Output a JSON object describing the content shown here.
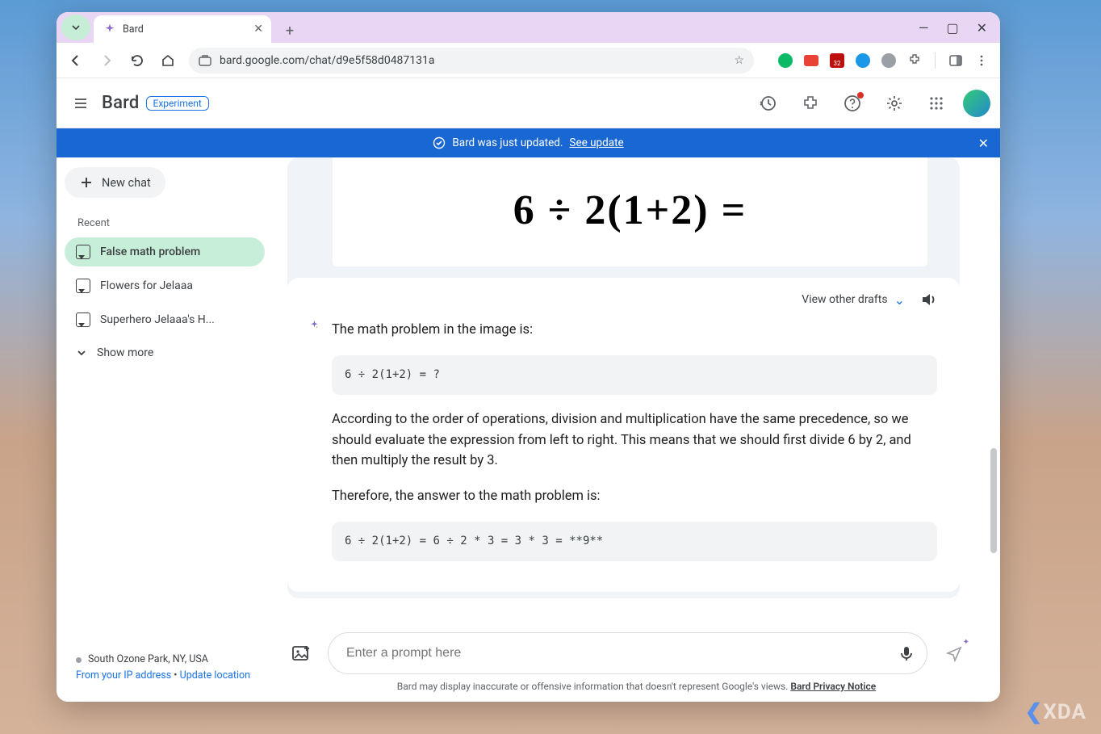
{
  "browser": {
    "tab_title": "Bard",
    "url": "bard.google.com/chat/d9e5f58d0487131a",
    "shield_badge": "32"
  },
  "header": {
    "brand": "Bard",
    "badge": "Experiment"
  },
  "banner": {
    "text": "Bard was just updated.",
    "link": "See update"
  },
  "sidebar": {
    "new_chat": "New chat",
    "section": "Recent",
    "items": [
      "False math problem",
      "Flowers for Jelaaa",
      "Superhero Jelaaa's H..."
    ],
    "show_more": "Show more",
    "location": "South Ozone Park, NY, USA",
    "ip_link": "From your IP address",
    "bullet": "•",
    "update_loc": "Update location"
  },
  "chat": {
    "math_display": "6 ÷ 2(1+2) =",
    "drafts_label": "View other drafts",
    "intro": "The math problem in the image is:",
    "code1": "6 ÷ 2(1+2) = ?",
    "para": "According to the order of operations, division and multiplication have the same precedence, so we should evaluate the expression from left to right. This means that we should first divide 6 by 2, and then multiply the result by 3.",
    "conclude": "Therefore, the answer to the math problem is:",
    "code2": "6 ÷ 2(1+2) = 6 ÷ 2 * 3 = 3 * 3 = **9**"
  },
  "input": {
    "placeholder": "Enter a prompt here"
  },
  "disclaimer": {
    "text": "Bard may display inaccurate or offensive information that doesn't represent Google's views. ",
    "link": "Bard Privacy Notice"
  },
  "watermark": "XDA"
}
